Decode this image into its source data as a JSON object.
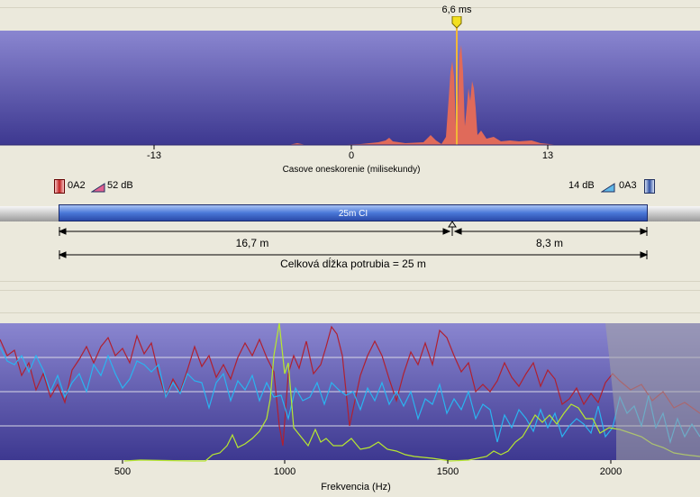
{
  "correlation": {
    "marker_label": "6,6 ms",
    "ticks": [
      "-13",
      "0",
      "13"
    ],
    "axis_label": "Casove oneskorenie (milisekundy)"
  },
  "pipe": {
    "left_sensor": "0A2",
    "left_gain": "52 dB",
    "right_gain": "14 dB",
    "right_sensor": "0A3",
    "section_label": "25m CI",
    "dist_left": "16,7 m",
    "dist_right": "8,3 m",
    "total": "Celková dĺžka potrubia = 25 m"
  },
  "spectrum": {
    "ticks": [
      "500",
      "1000",
      "1500",
      "2000"
    ],
    "axis_label": "Frekvencia (Hz)"
  },
  "colors": {
    "plot_top": "#8a86d0",
    "plot_bottom": "#3d3890",
    "peak": "#e06a5a",
    "pipe": "#4a78d8",
    "series_red": "#b02030",
    "series_cyan": "#2ab4f0",
    "series_green": "#b8e830"
  }
}
